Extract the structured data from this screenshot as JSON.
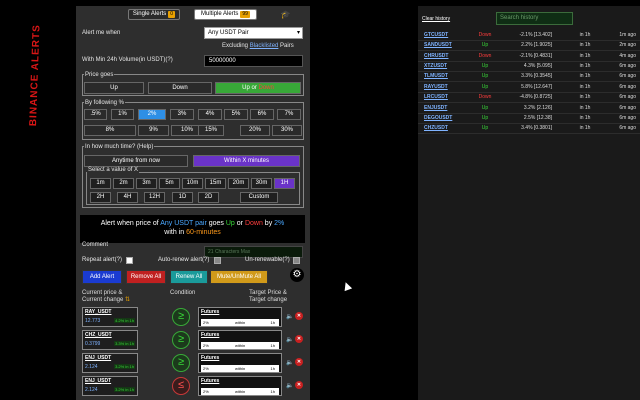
{
  "tabs": [
    {
      "label": "Single Alerts",
      "count": "0"
    },
    {
      "label": "Multiple Alerts",
      "count": "99"
    }
  ],
  "form": {
    "alert_me_when": "Alert me when",
    "pair_select": "Any USDT Pair",
    "excluding_prefix": "Excluding",
    "excluding_link": "Blacklisted",
    "excluding_suffix": "Pairs",
    "volume_label": "With Min 24h Volume(in USDT)(?)",
    "volume_value": "50000000",
    "price_goes": "Price goes",
    "direction": {
      "up": "Up",
      "down": "Down",
      "updown_up": "Up",
      "updown_or": " or ",
      "updown_down": "Down"
    },
    "by_following": "By following %",
    "percents_row1": [
      ".5%",
      "1%",
      "2%",
      "3%",
      "4%",
      "5%",
      "6%",
      "7%"
    ],
    "percents_row2": [
      "8%",
      "9%",
      "10%",
      "15%",
      "20%",
      "30%"
    ],
    "how_much_time": "In how much time? (Help)",
    "anytime": "Anytime from now",
    "within_x": "Within X minutes",
    "select_x": "Select a value of X",
    "times_row1": [
      "1m",
      "2m",
      "3m",
      "5m",
      "10m",
      "15m",
      "20m",
      "30m",
      "1H"
    ],
    "times_row2": [
      "2H",
      "4H",
      "12H",
      "1D",
      "2D",
      "Custom"
    ]
  },
  "message": {
    "p1": "Alert when price of ",
    "pair": "Any USDT pair",
    "p2": " goes ",
    "up": "Up",
    "or": " or ",
    "down": "Down",
    "p3": " by ",
    "pct": "2%",
    "p4": "with in ",
    "time": "60-minutes"
  },
  "comment": {
    "label": "Comment",
    "placeholder": "21 Characters Max"
  },
  "options": {
    "repeat": "Repeat alert(?)",
    "autorenew": "Auto-renew alert(?)",
    "unrenewable": "Un-renewable(?)"
  },
  "actions": {
    "add": "Add Alert",
    "remove": "Remove All",
    "renew": "Renew All",
    "mute": "Mute/UnMute All"
  },
  "colors": {
    "add": "#1a3bd1",
    "remove": "#c02020",
    "renew": "#1a9a9a",
    "mute": "#d19a1a"
  },
  "table_headers": {
    "current1": "Current price &",
    "current2": "Current change",
    "condition": "Condition",
    "target1": "Target Price &",
    "target2": "Target change"
  },
  "alerts": [
    {
      "pair": "RAY_USDT",
      "price": "12.773",
      "change": "4.2% in 1h",
      "type": "Futures",
      "pct": "2%",
      "within": "within",
      "tf": "1h"
    },
    {
      "pair": "CHZ_USDT",
      "price": "0.3799",
      "change": "3.3% in 1h",
      "type": "Futures",
      "pct": "2%",
      "within": "within",
      "tf": "1h"
    },
    {
      "pair": "ENJ_USDT",
      "price": "2.124",
      "change": "3.2% in 1h",
      "type": "Futures",
      "pct": "2%",
      "within": "within",
      "tf": "1h"
    },
    {
      "pair": "ENJ_USDT",
      "price": "2.124",
      "change": "3.2% in 1h",
      "type": "Futures",
      "pct": "2%",
      "within": "within",
      "tf": "1h"
    }
  ],
  "watermark": "BINANCE ALERTS",
  "history": {
    "clear": "Clear history",
    "search_placeholder": "Search history",
    "rows": [
      {
        "sym": "GTCUSDT",
        "dir": "Down",
        "pct": "-2.1% [13.402]",
        "tf": "in 1h",
        "ago": "1m ago"
      },
      {
        "sym": "SANDUSDT",
        "dir": "Up",
        "pct": "2.2% [1.9025]",
        "tf": "in 1h",
        "ago": "2m ago"
      },
      {
        "sym": "CHRUSDT",
        "dir": "Down",
        "pct": "-2.1% [0.4831]",
        "tf": "in 1h",
        "ago": "4m ago"
      },
      {
        "sym": "XTZUSDT",
        "dir": "Up",
        "pct": "4.3% [5.095]",
        "tf": "in 1h",
        "ago": "6m ago"
      },
      {
        "sym": "TLMUSDT",
        "dir": "Up",
        "pct": "3.3% [0.3545]",
        "tf": "in 1h",
        "ago": "6m ago"
      },
      {
        "sym": "RAYUSDT",
        "dir": "Up",
        "pct": "5.8% [12.647]",
        "tf": "in 1h",
        "ago": "6m ago"
      },
      {
        "sym": "LRCUSDT",
        "dir": "Down",
        "pct": "-4.8% [0.8725]",
        "tf": "in 1h",
        "ago": "6m ago"
      },
      {
        "sym": "ENJUSDT",
        "dir": "Up",
        "pct": "3.2% [2.126]",
        "tf": "in 1h",
        "ago": "6m ago"
      },
      {
        "sym": "DEGOUSDT",
        "dir": "Up",
        "pct": "2.5% [12.38]",
        "tf": "in 1h",
        "ago": "6m ago"
      },
      {
        "sym": "CHZUSDT",
        "dir": "Up",
        "pct": "3.4% [0.3801]",
        "tf": "in 1h",
        "ago": "6m ago"
      }
    ]
  }
}
